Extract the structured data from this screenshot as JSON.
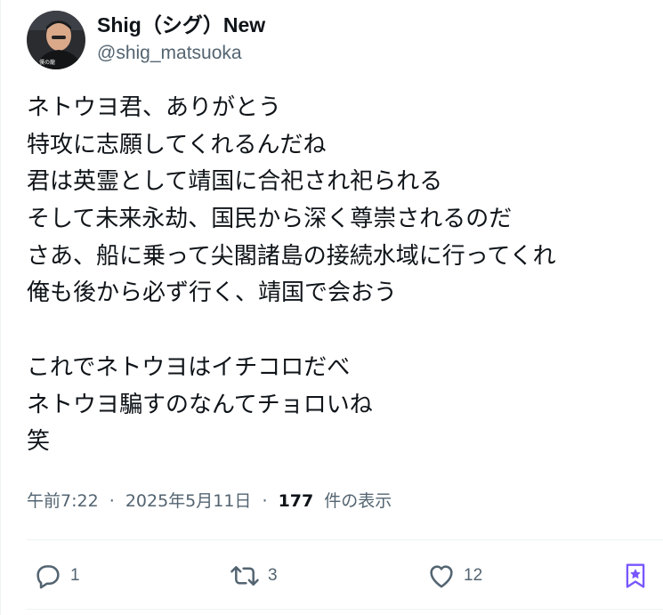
{
  "author": {
    "display_name": "Shig（シグ）New",
    "handle": "@shig_matsuoka"
  },
  "tweet": {
    "lines": [
      "ネトウヨ君、ありがとう",
      "特攻に志願してくれるんだね",
      "君は英霊として靖国に合祀され祀られる",
      "そして未来永劫、国民から深く尊崇されるのだ",
      "さあ、船に乗って尖閣諸島の接続水域に行ってくれ",
      "俺も後から必ず行く、靖国で会おう",
      "",
      "これでネトウヨはイチコロだべ",
      "ネトウヨ騙すのなんてチョロいね",
      "笑"
    ]
  },
  "meta": {
    "time": "午前7:22",
    "separator": "·",
    "date": "2025年5月11日",
    "views_count": "177",
    "views_label": "件の表示"
  },
  "actions": {
    "reply_count": "1",
    "retweet_count": "3",
    "like_count": "12",
    "icons": [
      "reply-icon",
      "retweet-icon",
      "heart-icon",
      "bookmark-icon"
    ],
    "bookmark_color": "#7856ff"
  }
}
